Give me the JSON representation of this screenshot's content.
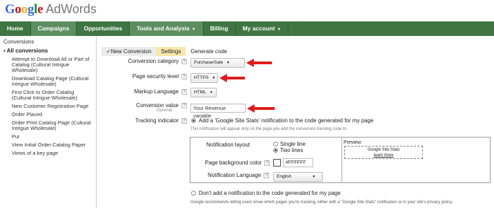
{
  "logo": {
    "google": "Google",
    "product": "AdWords"
  },
  "nav": {
    "tabs": [
      {
        "label": "Home"
      },
      {
        "label": "Campaigns"
      },
      {
        "label": "Opportunities"
      },
      {
        "label": "Tools and Analysis"
      },
      {
        "label": "Billing"
      },
      {
        "label": "My account"
      }
    ]
  },
  "sidebar": {
    "title": "Conversions",
    "all": "All conversions",
    "items": [
      "Attempt to Download All or Part of Catalog (Cultural Intrigue Wholesale)",
      "Download Catalog Page (Cultural Intrigue Wholesale)",
      "First Click to Order Catalog (Cultural Intrigue Wholesale)",
      "New Customer Registration Page",
      "Order Placed",
      "Order Print Catalog Page (Cultural Intrigue Wholesale)",
      "Pur",
      "View Initial Order Catalog Paper",
      "Views of a key page"
    ]
  },
  "steps": {
    "s1": "New Conversion",
    "s2": "Settings",
    "s3": "Generate code"
  },
  "form": {
    "category_label": "Conversion category",
    "category_value": "Purchase/Sale",
    "security_label": "Page security level",
    "security_value": "HTTPS",
    "markup_label": "Markup Language",
    "markup_value": "HTML",
    "value_label": "Conversion value",
    "value_optional": "Optional",
    "value_input": "Your Revenue variable",
    "tracking_label": "Tracking indicator",
    "tracking_opt1": "Add a 'Google Site Stats' notification to the code generated for my page",
    "tracking_note": "This notification will appear only on the page you add the conversion tracking code to.",
    "layout_label": "Notification layout",
    "layout_opt1": "Single line",
    "layout_opt2": "Two lines",
    "bg_label": "Page background color",
    "bg_value": "#FFFFFF",
    "lang_label": "Notification Language",
    "lang_value": "English",
    "preview_label": "Preview:",
    "preview_line1": "Google Site Stats",
    "preview_line2": "learn more",
    "tracking_opt2": "Don't add a notification to the code generated for my page",
    "footer": "Google recommends letting users know which pages you're tracking, either with a \"Google Site Stats\" notification or in your site's privacy policy."
  },
  "colors": {
    "nav_bg": "#3f7543",
    "nav_active": "#5d8e61",
    "step_current": "#f6e8a8",
    "arrow": "#e11b1b"
  }
}
